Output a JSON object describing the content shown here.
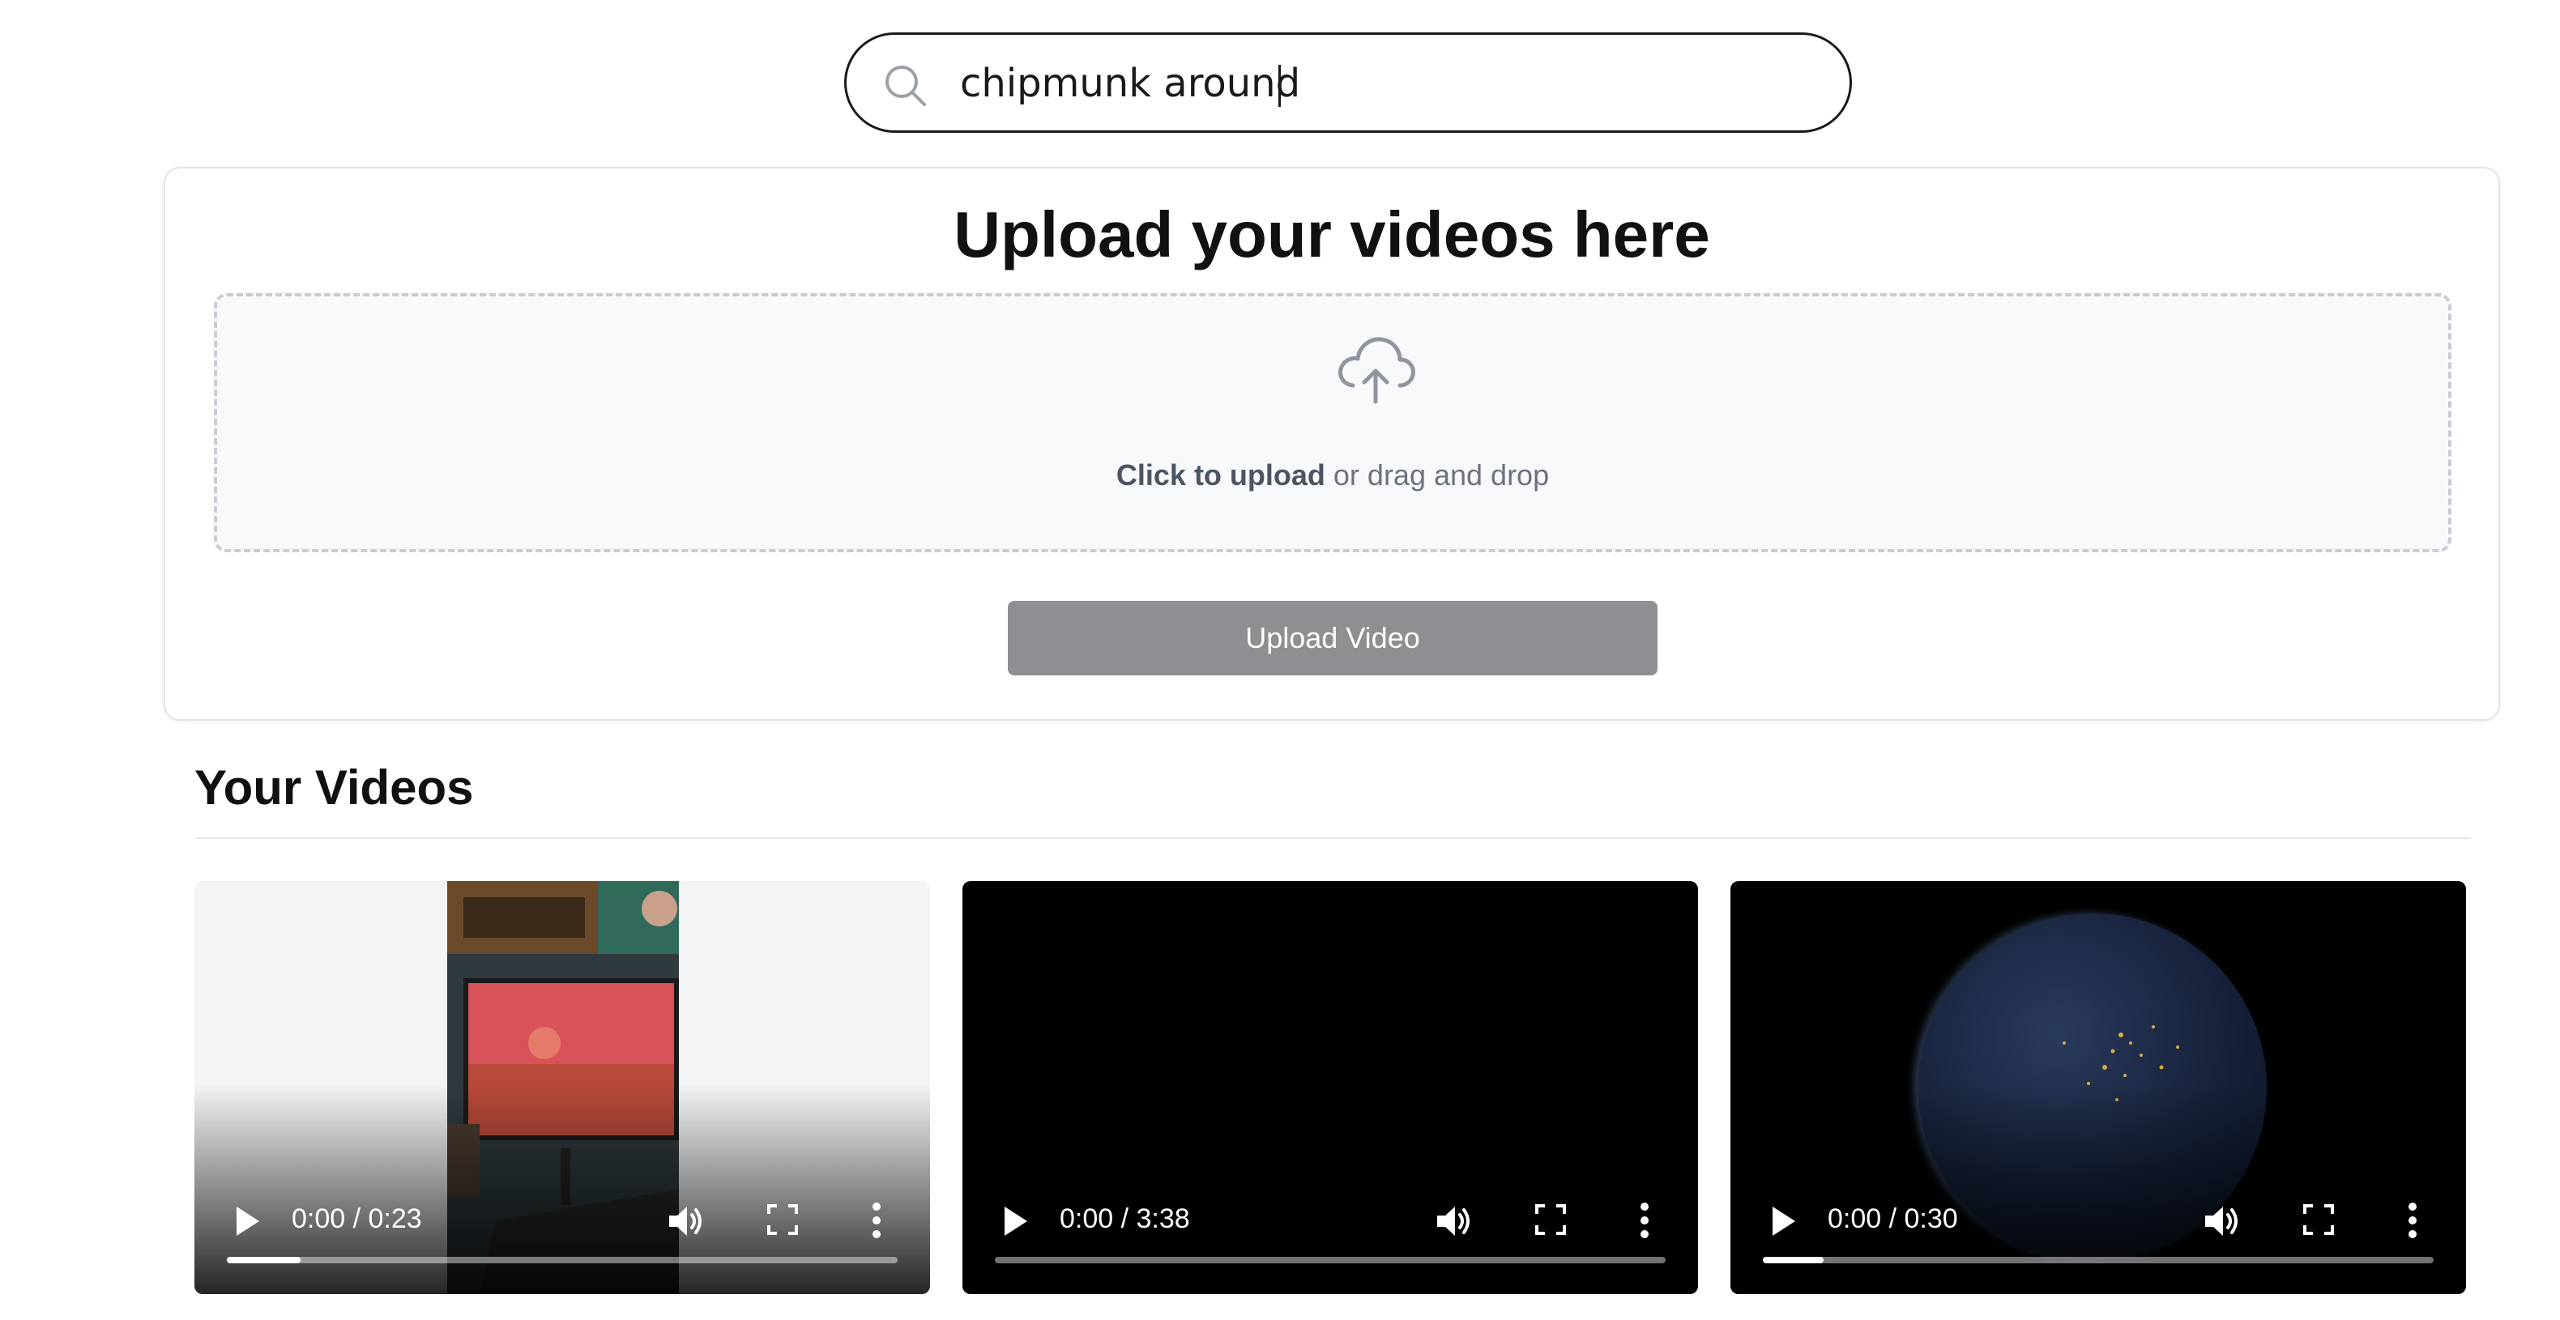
{
  "search": {
    "value": "chipmunk around ",
    "placeholder": ""
  },
  "upload": {
    "title": "Upload your videos here",
    "click_text": "Click to upload",
    "rest_text": " or drag and drop",
    "button_label": "Upload Video"
  },
  "videos_section": {
    "title": "Your Videos",
    "videos": [
      {
        "time": "0:00 / 0:23",
        "progress": 0.11
      },
      {
        "time": "0:00 / 3:38",
        "progress": 0.0
      },
      {
        "time": "0:00 / 0:30",
        "progress": 0.09
      }
    ]
  },
  "colors": {
    "button_bg": "#8e8f92",
    "dropzone_border": "#c9cdd3",
    "hint_text": "#6b7280"
  },
  "icons": [
    "search-icon",
    "cloud-upload-icon",
    "play-icon",
    "volume-icon",
    "fullscreen-icon",
    "more-options-icon"
  ]
}
